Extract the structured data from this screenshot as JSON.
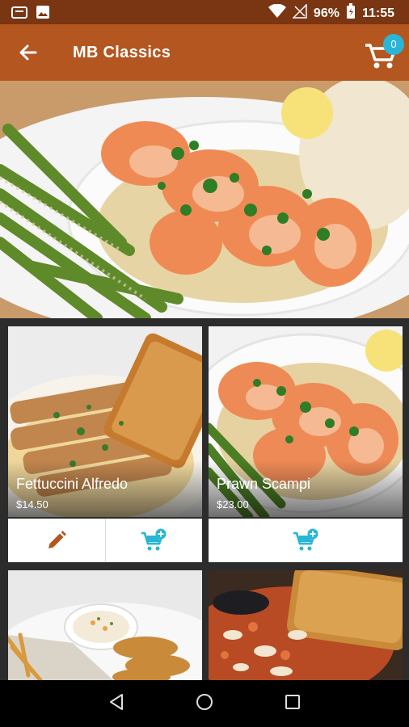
{
  "status": {
    "battery": "96%",
    "time": "11:55"
  },
  "app_bar": {
    "title": "MB Classics",
    "cart_count": "0"
  },
  "items": [
    {
      "name": "Fettuccini Alfredo",
      "price": "$14.50"
    },
    {
      "name": "Prawn Scampi",
      "price": "$23.00"
    }
  ],
  "colors": {
    "status_bar": "#7a3513",
    "app_bar": "#b4561f",
    "accent": "#29b6d6",
    "edit": "#b4561f"
  },
  "icons": [
    "folder-icon",
    "image-icon",
    "wifi-icon",
    "signal-icon",
    "battery-icon",
    "back-arrow-icon",
    "cart-icon",
    "pencil-icon",
    "add-to-cart-icon",
    "nav-back-icon",
    "nav-home-icon",
    "nav-recents-icon"
  ]
}
